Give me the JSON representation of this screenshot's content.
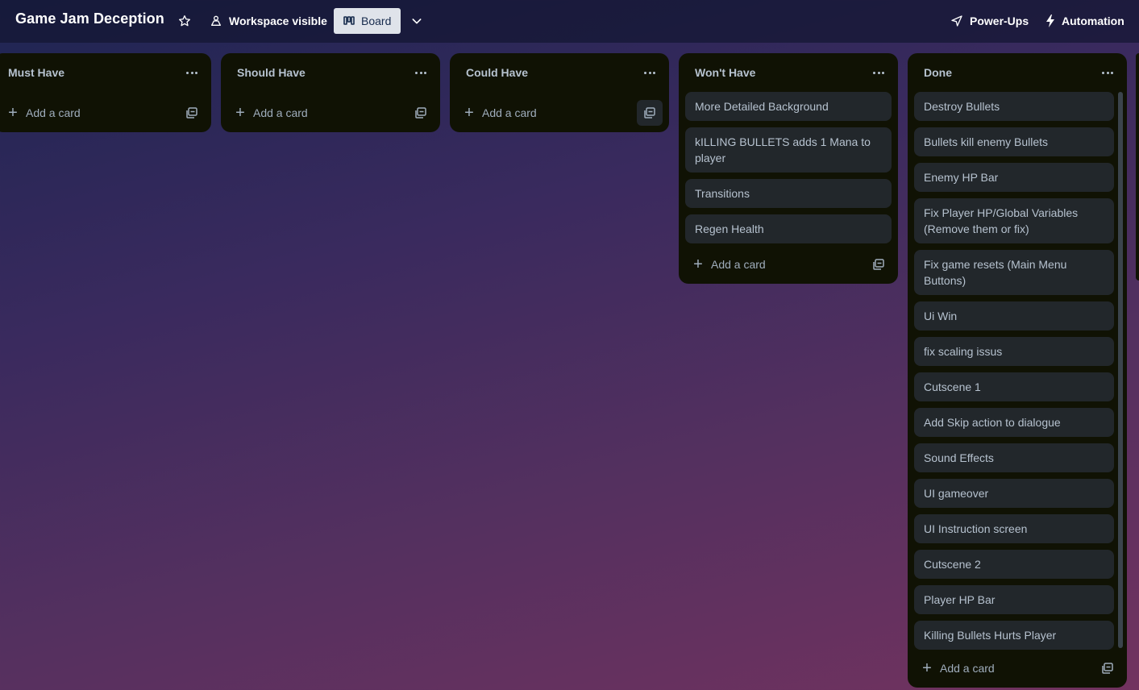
{
  "header": {
    "board_title": "Game Jam Deception",
    "star_icon": "star-icon",
    "workspace_label": "Workspace visible",
    "view_label": "Board",
    "powerups_label": "Power-Ups",
    "automation_label": "Automation"
  },
  "lists": {
    "must": {
      "title": "Must Have",
      "add_label": "Add a card"
    },
    "should": {
      "title": "Should Have",
      "add_label": "Add a card"
    },
    "could": {
      "title": "Could Have",
      "add_label": "Add a card"
    },
    "wont": {
      "title": "Won't Have",
      "add_label": "Add a card",
      "cards": [
        "More Detailed Background",
        "kILLING BULLETS adds 1 Mana to player",
        "Transitions",
        "Regen Health"
      ]
    },
    "done": {
      "title": "Done",
      "add_label": "Add a card",
      "cards": [
        "Destroy Bullets",
        "Bullets kill enemy Bullets",
        "Enemy HP Bar",
        "Fix Player HP/Global Variables (Remove them or fix)",
        "Fix game resets (Main Menu Buttons)",
        "Ui Win",
        "fix scaling issus",
        "Cutscene 1",
        "Add Skip action to dialogue",
        "Sound Effects",
        "UI gameover",
        "UI Instruction screen",
        "Cutscene 2",
        "Player HP Bar",
        "Killing Bullets Hurts Player"
      ]
    }
  },
  "colors": {
    "list_bg": "#101204",
    "card_bg": "#22272b",
    "text": "#b6c2cf",
    "header_bg": "#14163a"
  }
}
